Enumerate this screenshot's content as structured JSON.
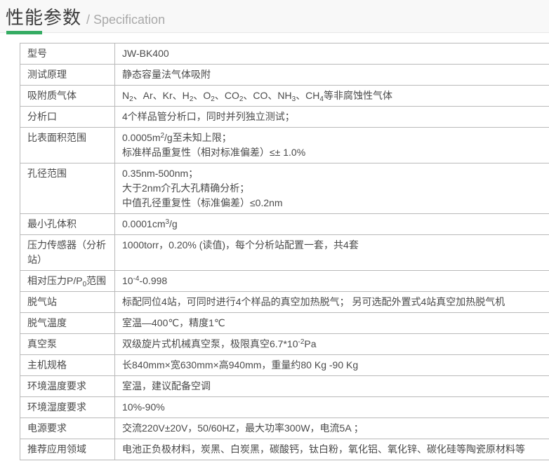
{
  "header": {
    "title_zh": "性能参数",
    "title_en": "/ Specification",
    "accent_color": "#35ac63",
    "band_background": "#f8f8f8"
  },
  "table": {
    "border_color": "#b9b9b9",
    "rows": [
      {
        "label": [
          {
            "t": "型号"
          }
        ],
        "lines": [
          [
            {
              "t": "JW-BK400"
            }
          ]
        ]
      },
      {
        "label": [
          {
            "t": "测试原理"
          }
        ],
        "lines": [
          [
            {
              "t": "静态容量法气体吸附"
            }
          ]
        ]
      },
      {
        "label": [
          {
            "t": "吸附质气体"
          }
        ],
        "lines": [
          [
            {
              "t": "N"
            },
            {
              "sub": "2"
            },
            {
              "t": "、Ar、Kr、H"
            },
            {
              "sub": "2"
            },
            {
              "t": "、O"
            },
            {
              "sub": "2"
            },
            {
              "t": "、CO"
            },
            {
              "sub": "2"
            },
            {
              "t": "、CO、NH"
            },
            {
              "sub": "3"
            },
            {
              "t": "、CH"
            },
            {
              "sub": "4"
            },
            {
              "t": "等非腐蚀性气体"
            }
          ]
        ]
      },
      {
        "label": [
          {
            "t": "分析口"
          }
        ],
        "lines": [
          [
            {
              "t": "4个样品管分析口，同时并列独立测试；"
            }
          ]
        ]
      },
      {
        "label": [
          {
            "t": "比表面积范围"
          }
        ],
        "lines": [
          [
            {
              "t": "0.0005m"
            },
            {
              "sup": "2"
            },
            {
              "t": "/g至未知上限；"
            }
          ],
          [
            {
              "t": "标准样品重复性（相对标准偏差）≤± 1.0%"
            }
          ]
        ]
      },
      {
        "label": [
          {
            "t": "孔径范围"
          }
        ],
        "lines": [
          [
            {
              "t": "0.35nm-500nm；"
            }
          ],
          [
            {
              "t": "大于2nm介孔大孔精确分析；"
            }
          ],
          [
            {
              "t": "中值孔径重复性（标准偏差）≤0.2nm"
            }
          ]
        ]
      },
      {
        "label": [
          {
            "t": "最小孔体积"
          }
        ],
        "lines": [
          [
            {
              "t": "0.0001cm"
            },
            {
              "sup": "3"
            },
            {
              "t": "/g"
            }
          ]
        ]
      },
      {
        "label": [
          {
            "t": "压力传感器（分析站）"
          }
        ],
        "lines": [
          [
            {
              "t": "1000torr，0.20% (读值)，每个分析站配置一套，共4套"
            }
          ]
        ]
      },
      {
        "label": [
          {
            "t": "相对压力P/P"
          },
          {
            "sub": "0"
          },
          {
            "t": "范围"
          }
        ],
        "lines": [
          [
            {
              "t": "10"
            },
            {
              "sup": "-4"
            },
            {
              "t": "-0.998"
            }
          ]
        ]
      },
      {
        "label": [
          {
            "t": "脱气站"
          }
        ],
        "lines": [
          [
            {
              "t": "标配同位4站，可同时进行4个样品的真空加热脱气； 另可选配外置式4站真空加热脱气机"
            }
          ]
        ]
      },
      {
        "label": [
          {
            "t": "脱气温度"
          }
        ],
        "lines": [
          [
            {
              "t": "室温—400℃，精度1℃"
            }
          ]
        ]
      },
      {
        "label": [
          {
            "t": "真空泵"
          }
        ],
        "lines": [
          [
            {
              "t": "双级旋片式机械真空泵，极限真空6.7*10"
            },
            {
              "sup": "-2"
            },
            {
              "t": "Pa"
            }
          ]
        ]
      },
      {
        "label": [
          {
            "t": "主机规格"
          }
        ],
        "lines": [
          [
            {
              "t": "长840mm×宽630mm×高940mm，重量约80 Kg -90 Kg"
            }
          ]
        ]
      },
      {
        "label": [
          {
            "t": "环境温度要求"
          }
        ],
        "lines": [
          [
            {
              "t": "室温，建议配备空调"
            }
          ]
        ]
      },
      {
        "label": [
          {
            "t": "环境湿度要求"
          }
        ],
        "lines": [
          [
            {
              "t": "10%-90%"
            }
          ]
        ]
      },
      {
        "label": [
          {
            "t": "电源要求"
          }
        ],
        "lines": [
          [
            {
              "t": "交流220V±20V，50/60HZ，最大功率300W，电流5A ；"
            }
          ]
        ]
      },
      {
        "label": [
          {
            "t": "推荐应用领域"
          }
        ],
        "lines": [
          [
            {
              "t": "电池正负极材料，炭黑、白炭黑，碳酸钙，钛白粉，氧化铝、氧化锌、碳化硅等陶瓷原材料等"
            }
          ]
        ]
      }
    ]
  }
}
